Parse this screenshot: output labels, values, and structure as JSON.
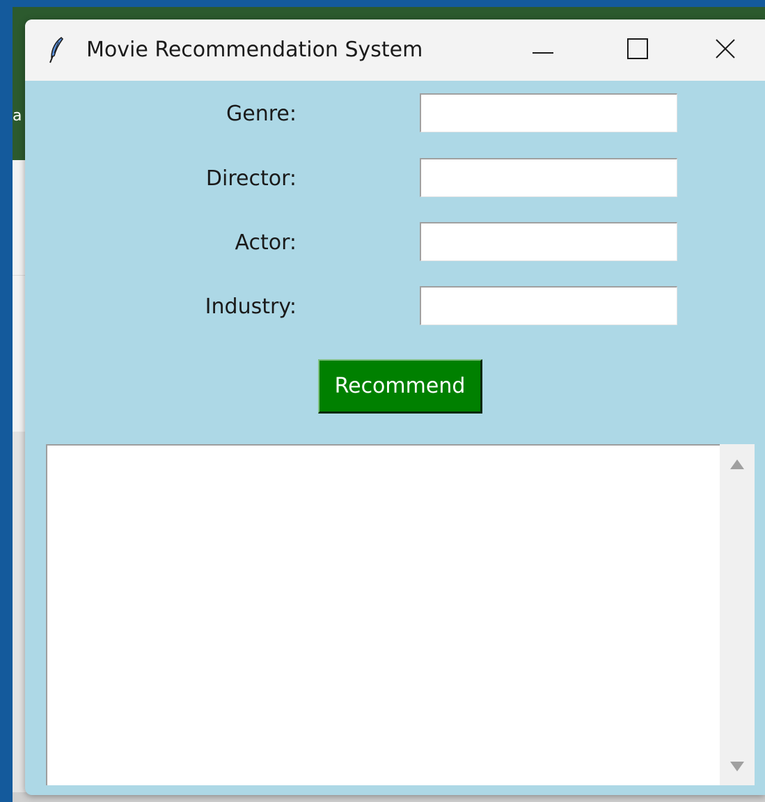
{
  "window": {
    "title": "Movie Recommendation System",
    "background_color": "#add8e6",
    "icon": "feather-icon"
  },
  "background": {
    "peek_letter": "a"
  },
  "form": {
    "fields": [
      {
        "label": "Genre:",
        "value": ""
      },
      {
        "label": "Director:",
        "value": ""
      },
      {
        "label": "Actor:",
        "value": ""
      },
      {
        "label": "Industry:",
        "value": ""
      }
    ],
    "button_label": "Recommend",
    "button_color": "#008000"
  },
  "output": {
    "text": ""
  }
}
